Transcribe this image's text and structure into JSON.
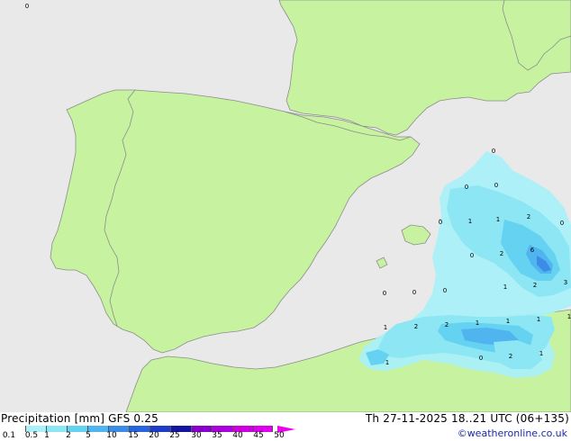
{
  "header": {
    "title_left": "Precipitation [mm]  GFS 0.25",
    "title_right": "Th 27-11-2025 18..21 UTC (06+135)",
    "credit": "©weatheronline.co.uk"
  },
  "legend": {
    "levels": [
      "0.1",
      "0.5",
      "1",
      "2",
      "5",
      "10",
      "15",
      "20",
      "25",
      "30",
      "35",
      "40",
      "45",
      "50"
    ],
    "colors": [
      "#ffffff",
      "#aaf0f8",
      "#8ce6f4",
      "#64d2f0",
      "#50b4ee",
      "#3c8ce6",
      "#2864dc",
      "#1e3cc8",
      "#1414a0",
      "#8800cc",
      "#aa00dd",
      "#cc00dd",
      "#dd00ee",
      "#ee00ee"
    ]
  },
  "map": {
    "colors": {
      "sea": "#e9e9e9",
      "land": "#c7f3a0",
      "coast": "#8c8c8c",
      "border": "#8c8c8c"
    },
    "value_labels": [
      {
        "text": "0"
      },
      {
        "text": "0"
      },
      {
        "text": "0"
      },
      {
        "text": "0"
      },
      {
        "text": "1"
      },
      {
        "text": "1"
      },
      {
        "text": "2"
      },
      {
        "text": "0"
      },
      {
        "text": "0"
      },
      {
        "text": "2"
      },
      {
        "text": "6"
      },
      {
        "text": "0"
      },
      {
        "text": "1"
      },
      {
        "text": "2"
      },
      {
        "text": "3"
      },
      {
        "text": "0"
      },
      {
        "text": "0"
      },
      {
        "text": "0"
      },
      {
        "text": "1"
      },
      {
        "text": "2"
      },
      {
        "text": "2"
      },
      {
        "text": "1"
      },
      {
        "text": "1"
      },
      {
        "text": "1"
      },
      {
        "text": "1"
      },
      {
        "text": "0"
      },
      {
        "text": "2"
      },
      {
        "text": "1"
      },
      {
        "text": "1"
      }
    ]
  }
}
